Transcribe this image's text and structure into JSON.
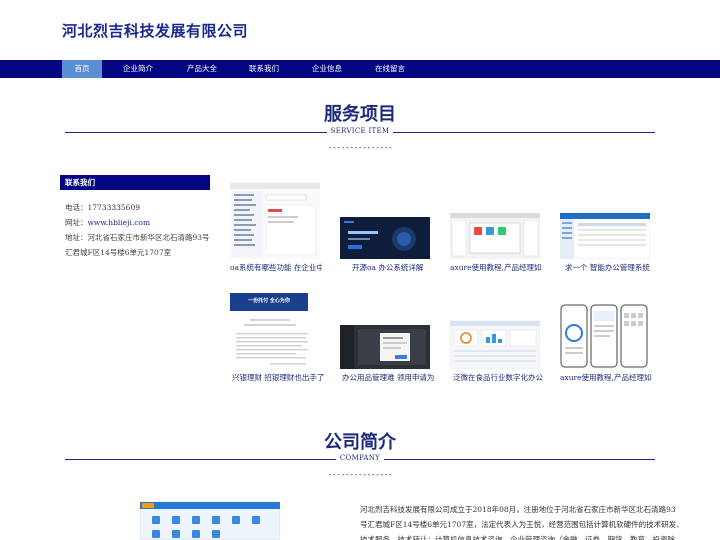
{
  "site": {
    "title": "河北烈吉科技发展有限公司"
  },
  "nav": {
    "items": [
      "首页",
      "企业简介",
      "产品大全",
      "联系我们",
      "企业信息",
      "在线留言"
    ]
  },
  "services": {
    "title": "服务项目",
    "subtitle": "SERVICE ITEM",
    "dashes": "---------------"
  },
  "contact": {
    "heading": "联系我们",
    "phone_label": "电话：",
    "phone": "17733335609",
    "web_label": "网址：",
    "web": "www.hblieji.com",
    "addr_label": "地址：",
    "addr_line1": "河北省石家庄市新华区北石清路93号",
    "addr_line2": "汇君城F区14号楼6单元1707室"
  },
  "products": [
    {
      "caption": "oa系统有哪些功能 在企业中"
    },
    {
      "caption": "开源oa 办公系统详解"
    },
    {
      "caption": "axure使用教程,产品经理如何"
    },
    {
      "caption": "求一个 智能办公管理系统"
    },
    {
      "caption": "兴银理财 招银理财也出手了"
    },
    {
      "caption": "办公用品管理难 领用申请为"
    },
    {
      "caption": "泛微在食品行业数字化办公"
    },
    {
      "caption": "axure使用教程,产品经理如何"
    }
  ],
  "thumb_texts": {
    "banner": "一份托付 全心为你"
  },
  "company": {
    "title": "公司简介",
    "subtitle": "COMPANY",
    "dashes": "---------------",
    "intro_line1": "河北烈吉科技发展有限公司成立于2018年08月，注册地位于河北省石家庄市新华区北石清路93",
    "intro_line2": "号汇君城F区14号楼6单元1707室，法定代表人为王悦，经营范围包括计算机软硬件的技术研发、",
    "intro_line3": "技术服务、技术转让；计算机信息技术咨询，企业管理咨询（金融、证券、期货、教育、投资除"
  },
  "colors": {
    "nav_bg": "#050582",
    "nav_active": "#5a8fd6",
    "title": "#1d2a7a"
  }
}
